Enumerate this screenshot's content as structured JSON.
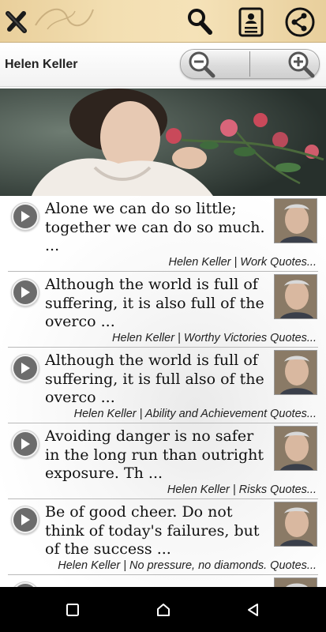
{
  "toolbar": {
    "close_icon": "close-x-icon",
    "search_icon": "magnifier-icon",
    "book_icon": "author-book-icon",
    "share_icon": "share-icon"
  },
  "header": {
    "author": "Helen Keller",
    "zoom_out_icon": "zoom-out-icon",
    "zoom_in_icon": "zoom-in-icon"
  },
  "quotes": [
    {
      "text": "Alone we can do so little; together we can do so much. ...",
      "meta": "Helen Keller | Work Quotes..."
    },
    {
      "text": "Although the world is full of suffering, it is also full of the overco ...",
      "meta": "Helen Keller | Worthy Victories Quotes..."
    },
    {
      "text": "Although the world is full of suffering, it is full also of the overco ...",
      "meta": "Helen Keller | Ability and Achievement Quotes..."
    },
    {
      "text": "Avoiding danger is no safer in the long run than outright exposure. Th ...",
      "meta": "Helen Keller | Risks Quotes..."
    },
    {
      "text": "Be of good cheer. Do not think of today's failures, but of the success ...",
      "meta": "Helen Keller | No pressure, no diamonds. Quotes..."
    }
  ],
  "colors": {
    "toolbar_bg": "#f3dfb2",
    "play_button": "#6c6c6c",
    "navbar_bg": "#000000"
  }
}
